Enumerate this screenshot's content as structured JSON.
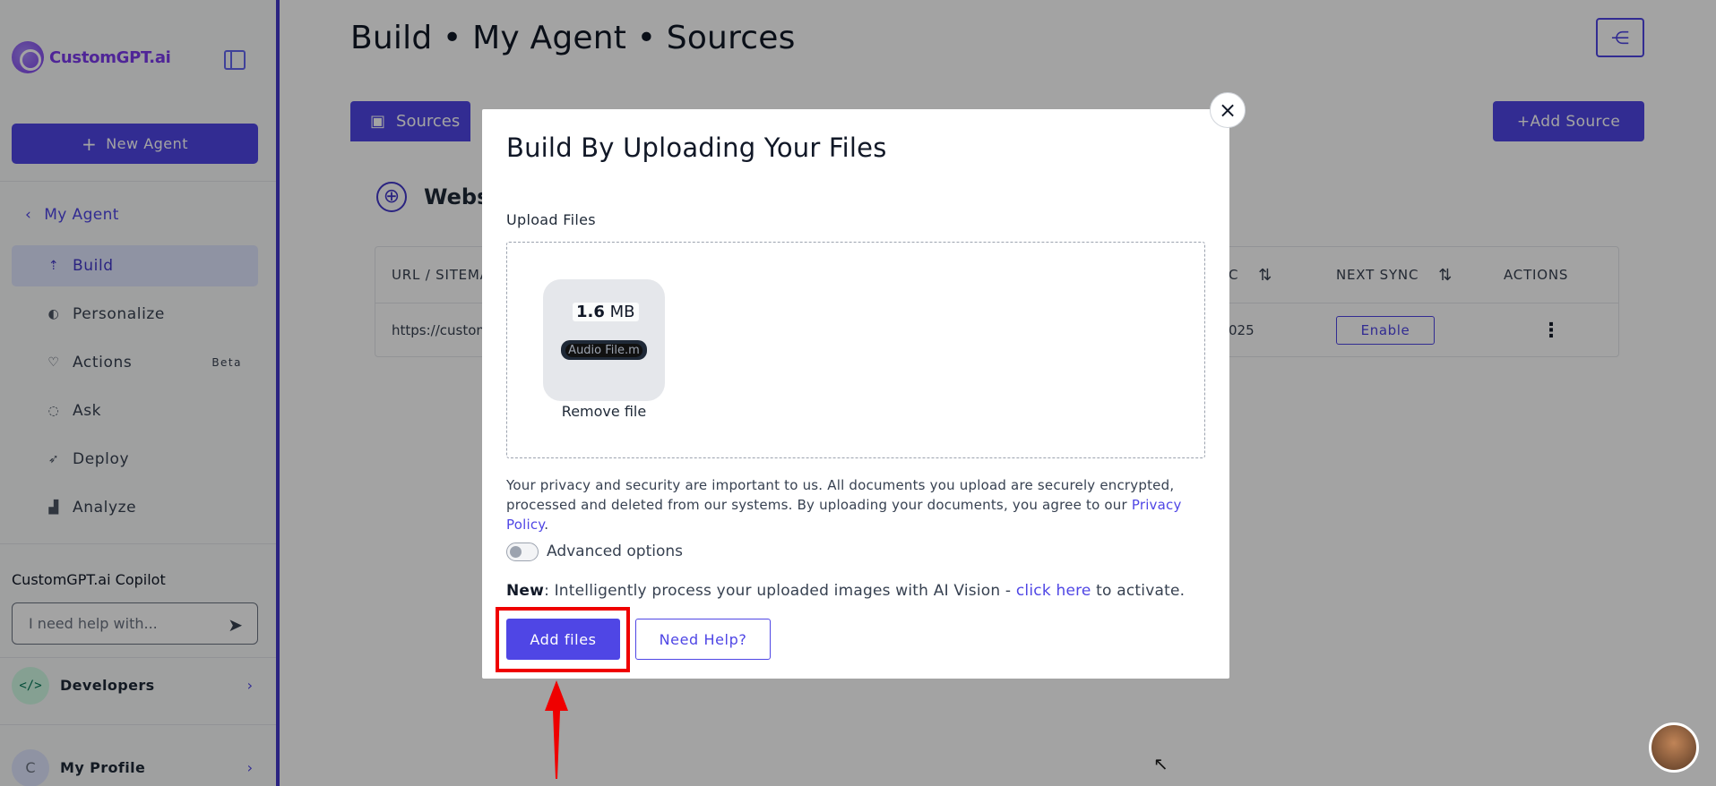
{
  "sidebar": {
    "brand": "CustomGPT.ai",
    "new_agent_label": "New Agent",
    "back_label": "My Agent",
    "items": [
      {
        "label": "Build",
        "icon": "build-icon"
      },
      {
        "label": "Personalize",
        "icon": "palette-icon"
      },
      {
        "label": "Actions",
        "icon": "heart-icon",
        "badge": "Beta"
      },
      {
        "label": "Ask",
        "icon": "chat-icon"
      },
      {
        "label": "Deploy",
        "icon": "rocket-icon"
      },
      {
        "label": "Analyze",
        "icon": "bar-chart-icon"
      }
    ],
    "copilot_title": "CustomGPT.ai Copilot",
    "copilot_placeholder": "I need help with...",
    "developers_label": "Developers",
    "profile_label": "My Profile",
    "profile_initial": "C"
  },
  "header": {
    "title": "Build • My Agent • Sources"
  },
  "tabs": {
    "sources_label": "Sources",
    "add_source_label": "Add Source"
  },
  "card": {
    "title": "Websi",
    "columns": [
      "URL / SITEMA",
      "C",
      "NEXT SYNC",
      "ACTIONS"
    ],
    "row": {
      "url": "https://custom",
      "date_tail": "025",
      "enable_label": "Enable"
    }
  },
  "modal": {
    "title": "Build By Uploading Your Files",
    "upload_label": "Upload Files",
    "file": {
      "size_value": "1.6",
      "size_unit": "MB",
      "name": "Audio File.m",
      "remove_label": "Remove file"
    },
    "privacy_text": "Your privacy and security are important to us. All documents you upload are securely encrypted, processed and deleted from our systems. By uploading your documents, you agree to our ",
    "privacy_link": "Privacy Policy",
    "advanced_label": "Advanced options",
    "new_prefix": "New",
    "new_text": ": Intelligently process your uploaded images with AI Vision - ",
    "new_link": "click here",
    "new_suffix": " to activate.",
    "add_files_label": "Add files",
    "need_help_label": "Need Help?"
  },
  "colors": {
    "accent": "#4f46e5",
    "highlight": "#ef0000"
  }
}
